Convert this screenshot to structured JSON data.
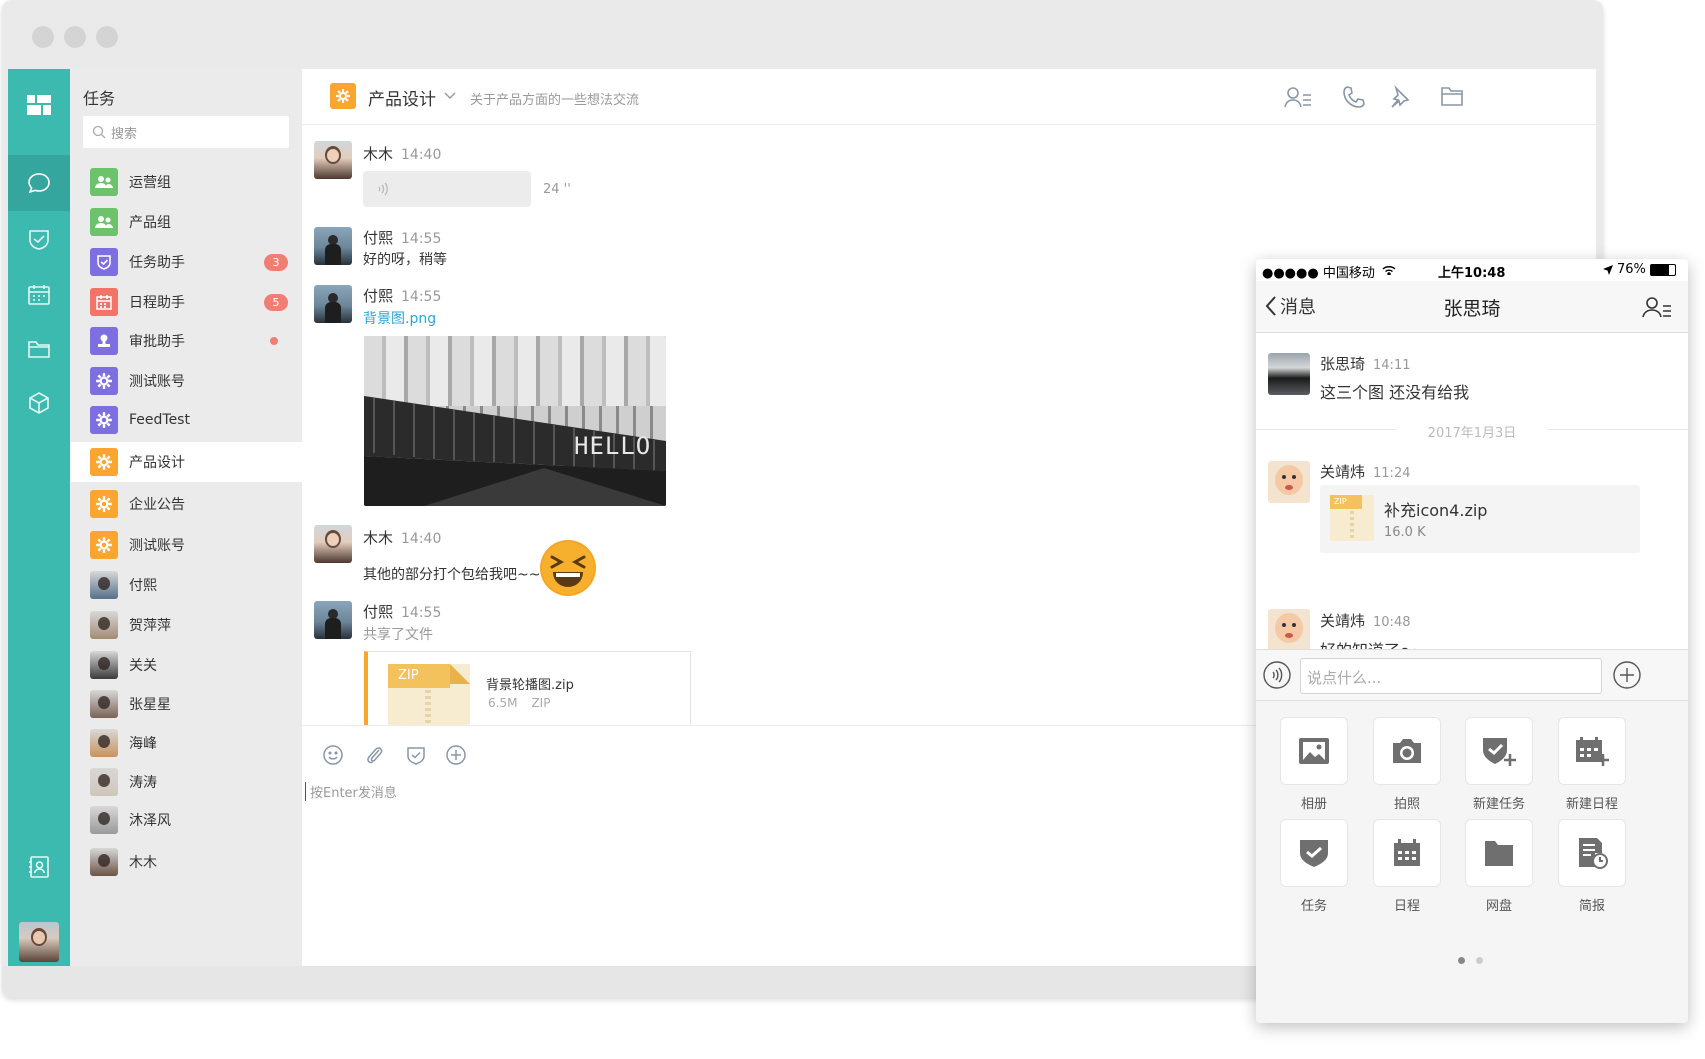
{
  "colors": {
    "accent": "#3cbab0",
    "orange": "#fba531",
    "badge": "#f07e73",
    "link": "#2aa6d9"
  },
  "list": {
    "title": "任务",
    "search_placeholder": "搜索",
    "items": [
      {
        "label": "运营组",
        "icon": "group-icon",
        "color": "#6dc36b"
      },
      {
        "label": "产品组",
        "icon": "group-icon",
        "color": "#6dc36b"
      },
      {
        "label": "任务助手",
        "icon": "task-icon",
        "color": "#7e6fe0",
        "badge": "3"
      },
      {
        "label": "日程助手",
        "icon": "calendar-icon",
        "color": "#f27368",
        "badge": "5"
      },
      {
        "label": "审批助手",
        "icon": "approval-icon",
        "color": "#7e6fe0"
      },
      {
        "label": "测试账号",
        "icon": "gear-icon",
        "color": "#7e6fe0"
      },
      {
        "label": "FeedTest",
        "icon": "gear-icon",
        "color": "#7e6fe0"
      },
      {
        "label": "产品设计",
        "icon": "gear-icon",
        "color": "#fba531"
      },
      {
        "label": "企业公告",
        "icon": "gear-icon",
        "color": "#fba531"
      },
      {
        "label": "测试账号",
        "icon": "gear-icon",
        "color": "#fba531"
      },
      {
        "label": "付熙",
        "icon": "avatar",
        "color": "#55708a"
      },
      {
        "label": "贺萍萍",
        "icon": "avatar",
        "color": "#a38b73"
      },
      {
        "label": "关关",
        "icon": "avatar",
        "color": "#3b3b3b"
      },
      {
        "label": "张星星",
        "icon": "avatar",
        "color": "#7a6355"
      },
      {
        "label": "海峰",
        "icon": "avatar",
        "color": "#c8935c"
      },
      {
        "label": "涛涛",
        "icon": "avatar",
        "color": "#cfc6b9"
      },
      {
        "label": "沐泽风",
        "icon": "avatar",
        "color": "#9a9a9a"
      },
      {
        "label": "木木",
        "icon": "avatar",
        "color": "#6b5447"
      }
    ]
  },
  "header": {
    "title": "产品设计",
    "subtitle": "关于产品方面的一些想法交流"
  },
  "messages": {
    "m1": {
      "name": "木木",
      "time": "14:40",
      "voice_duration": "24 ''"
    },
    "m2": {
      "name": "付熙",
      "time": "14:55",
      "text": "好的呀，稍等"
    },
    "m3": {
      "name": "付熙",
      "time": "14:55",
      "file_link": "背景图.png",
      "image_text": "HELLO"
    },
    "m4": {
      "name": "木木",
      "time": "14:40",
      "text": "其他的部分打个包给我吧~~~"
    },
    "m5": {
      "name": "付熙",
      "time": "14:55",
      "text": "共享了文件",
      "file_name": "背景轮播图.zip",
      "file_size": "6.5M",
      "file_type": "ZIP",
      "file_badge": "ZIP"
    }
  },
  "composer": {
    "placeholder": "按Enter发消息"
  },
  "phone": {
    "status": {
      "carrier": "●●●●● 中国移动",
      "time": "上午10:48",
      "battery": "76%"
    },
    "nav": {
      "back": "消息",
      "title": "张思琦"
    },
    "msgs": {
      "a": {
        "name": "张思琦",
        "time": "14:11",
        "text": "这三个图 还没有给我"
      },
      "date_sep": "2017年1月3日",
      "b": {
        "name": "关靖炜",
        "time": "11:24",
        "file_name": "补充icon4.zip",
        "file_size": "16.0 K",
        "file_badge": "ZIP"
      },
      "c": {
        "name": "关靖炜",
        "time": "10:48",
        "text": "好的知道了～"
      }
    },
    "input_placeholder": "说点什么...",
    "actions": [
      "相册",
      "拍照",
      "新建任务",
      "新建日程",
      "任务",
      "日程",
      "网盘",
      "简报"
    ]
  }
}
